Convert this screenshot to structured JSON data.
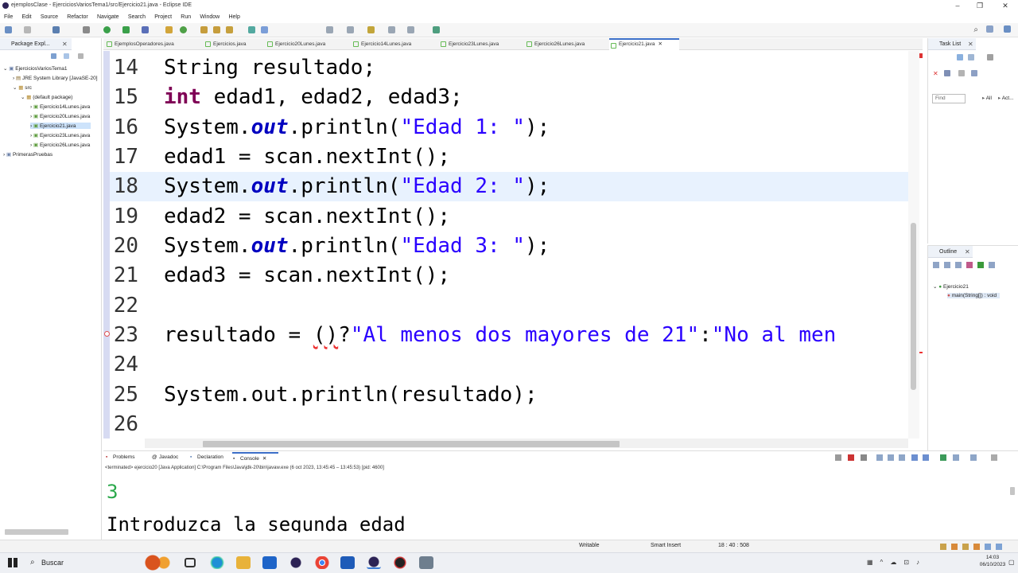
{
  "window": {
    "title": "ejemplosClase - EjerciciosVariosTema1/src/Ejercicio21.java - Eclipse IDE"
  },
  "menu": [
    "File",
    "Edit",
    "Source",
    "Refactor",
    "Navigate",
    "Search",
    "Project",
    "Run",
    "Window",
    "Help"
  ],
  "package_explorer": {
    "tab_label": "Package Expl...",
    "items": [
      "EjerciciosVariosTema1",
      "JRE System Library [JavaSE-20]",
      "src",
      "(default package)",
      "Ejercicio14Lunes.java",
      "Ejercicio20Lunes.java",
      "Ejercicio21.java",
      "Ejercicio23Lunes.java",
      "Ejercicio26Lunes.java",
      "PrimerasPruebas"
    ]
  },
  "editor_tabs": [
    "EjemplosOperadores.java",
    "Ejercicios.java",
    "Ejercicio20Lunes.java",
    "Ejercicio14Lunes.java",
    "Ejercicio23Lunes.java",
    "Ejercicio26Lunes.java",
    "Ejercicio21.java"
  ],
  "code_lines": [
    {
      "num": "14",
      "a": "String resultado;"
    },
    {
      "num": "15",
      "kw": "int",
      "a": " edad1, edad2, edad3;"
    },
    {
      "num": "16",
      "a": "System.",
      "fld": "out",
      "b": ".println(",
      "str": "\"Edad 1: \"",
      "c": ");"
    },
    {
      "num": "17",
      "a": "edad1 = scan.nextInt();"
    },
    {
      "num": "18",
      "a": "System.",
      "fld": "out",
      "b": ".println(",
      "str": "\"Edad 2: \"",
      "c": ");"
    },
    {
      "num": "19",
      "a": "edad2 = scan.nextInt();"
    },
    {
      "num": "20",
      "a": "System.",
      "fld": "out",
      "b": ".println(",
      "str": "\"Edad 3: \"",
      "c": ");"
    },
    {
      "num": "21",
      "a": "edad3 = scan.nextInt();"
    },
    {
      "num": "22",
      "a": ""
    },
    {
      "num": "23",
      "a": "resultado = ",
      "err": "()",
      "b": "?",
      "str": "\"Al menos dos mayores de 21\"",
      "c": ":",
      "str2": "\"No al men"
    },
    {
      "num": "24",
      "a": ""
    },
    {
      "num": "25",
      "a": "System.out.println(resultado);"
    },
    {
      "num": "26",
      "a": ""
    }
  ],
  "task_list": {
    "tab_label": "Task List",
    "find_placeholder": "Find",
    "all_label": "All",
    "act_label": "Act..."
  },
  "outline": {
    "tab_label": "Outline",
    "items": [
      "Ejercicio21",
      "main(String[]) : void"
    ]
  },
  "bottom_tabs": [
    "Problems",
    "Javadoc",
    "Declaration",
    "Console"
  ],
  "console": {
    "terminated": "<terminated> ejercicio20 [Java Application] C:\\Program Files\\Java\\jdk-20\\bin\\javaw.exe (6 oct 2023, 13:45:45 – 13:45:53) [pid: 4600]",
    "output_number": "3",
    "output_prompt": "Introduzca la segunda edad"
  },
  "status_bar": {
    "writable": "Writable",
    "insert_mode": "Smart Insert",
    "position": "18 : 40 : 508"
  },
  "taskbar": {
    "search_label": "Buscar",
    "time": "14:03",
    "date": "06/10/2023"
  }
}
